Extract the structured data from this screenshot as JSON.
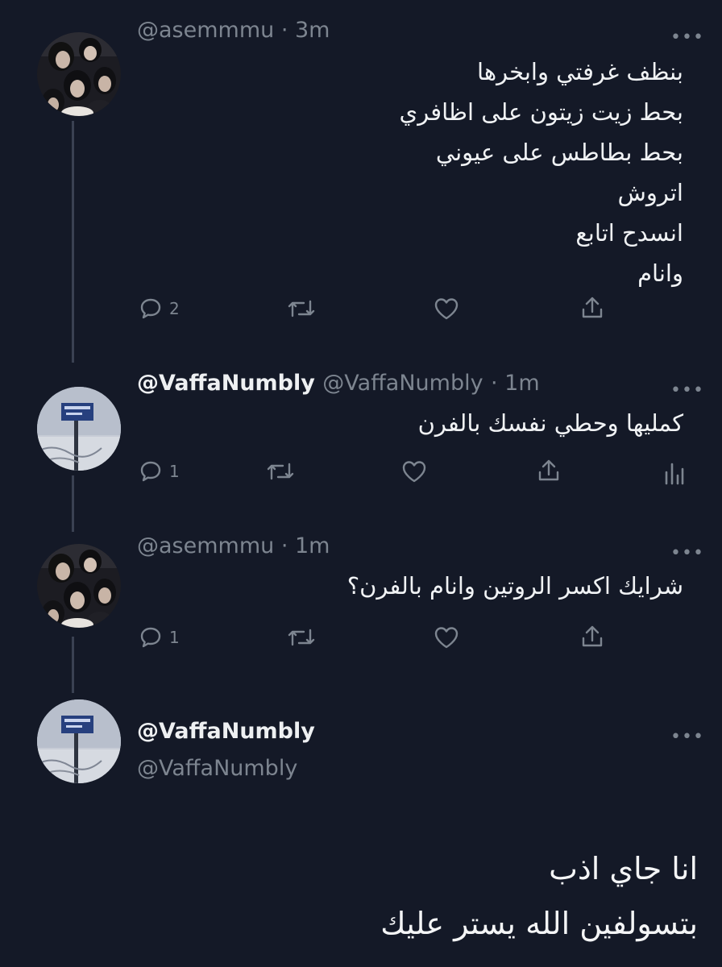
{
  "tweets": [
    {
      "handle": "@asemmmu",
      "time": "· 3m",
      "lines": [
        "بنظف غرفتي وابخرها",
        "بحط زيت زيتون على اظافري",
        "بحط بطاطس على عيوني",
        "اتروش",
        "انسدح اتابع",
        "وانام"
      ],
      "reply_count": "2"
    },
    {
      "display_name": "@VaffaNumbly",
      "handle": "@VaffaNumbly",
      "time": "· 1m",
      "lines": [
        "كمليها وحطي نفسك بالفرن"
      ],
      "reply_count": "1"
    },
    {
      "handle": "@asemmmu",
      "time": "· 1m",
      "lines": [
        "شرايك اكسر الروتين وانام بالفرن؟"
      ],
      "reply_count": "1"
    },
    {
      "display_name": "@VaffaNumbly",
      "handle": "@VaffaNumbly"
    }
  ],
  "more_glyph": "•••",
  "caption": {
    "line1": "انا جاي اذب",
    "line2": "بتسولفين الله يستر عليك"
  },
  "colors": {
    "background": "#141927",
    "thread_line": "#3a4152",
    "secondary_text": "#7d8590"
  },
  "icons": [
    "reply-icon",
    "retweet-icon",
    "like-icon",
    "share-icon",
    "analytics-icon",
    "more-icon"
  ]
}
